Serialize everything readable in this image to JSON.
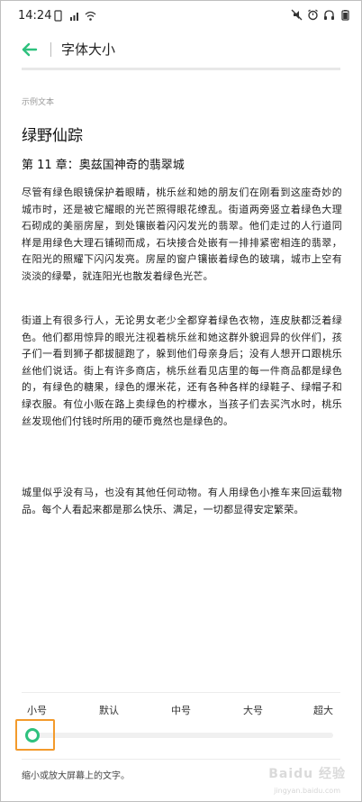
{
  "status_bar": {
    "time": "14:24",
    "left_icons": [
      "sim-icon",
      "signal-icon",
      "wifi-icon"
    ],
    "right_icons": [
      "mute-icon",
      "alarm-icon",
      "headphones-icon",
      "battery-icon"
    ]
  },
  "header": {
    "back_icon": "arrow-left-icon",
    "title": "字体大小",
    "accent_color": "#2ec17e"
  },
  "preview": {
    "label": "示例文本",
    "book_title": "绿野仙踪",
    "chapter_title": "第 11 章：奥兹国神奇的翡翠城",
    "paragraphs": [
      "尽管有绿色眼镜保护着眼睛，桃乐丝和她的朋友们在刚看到这座奇妙的城市时，还是被它耀眼的光芒照得眼花缭乱。街道两旁竖立着绿色大理石砌成的美丽房屋，到处镶嵌着闪闪发光的翡翠。他们走过的人行道同样是用绿色大理石铺砌而成，石块接合处嵌有一排排紧密相连的翡翠，在阳光的照耀下闪闪发亮。房屋的窗户镶嵌着绿色的玻璃，城市上空有淡淡的绿晕，就连阳光也散发着绿色光芒。",
      "街道上有很多行人，无论男女老少全都穿着绿色衣物，连皮肤都泛着绿色。他们都用惊异的眼光注视着桃乐丝和她这群外貌迥异的伙伴们，孩子们一看到狮子都拔腿跑了，躲到他们母亲身后；没有人想开口跟桃乐丝他们说话。街上有许多商店，桃乐丝看见店里的每一件商品都是绿色的，有绿色的糖果，绿色的爆米花，还有各种各样的绿鞋子、绿帽子和绿衣服。有位小贩在路上卖绿色的柠檬水，当孩子们去买汽水时，桃乐丝发现他们付钱时所用的硬币竟然也是绿色的。",
      "城里似乎没有马，也没有其他任何动物。有人用绿色小推车来回运载物品。每个人看起来都是那么快乐、满足，一切都显得安定繁荣。"
    ]
  },
  "font_size": {
    "options": [
      "小号",
      "默认",
      "中号",
      "大号",
      "超大"
    ],
    "selected": "小号",
    "selected_index": 0,
    "hint": "缩小或放大屏幕上的文字。",
    "highlight_color": "#f39a2b"
  },
  "watermark": {
    "text": "Baidu 经验",
    "sub": "jingyan.baidu.com"
  }
}
